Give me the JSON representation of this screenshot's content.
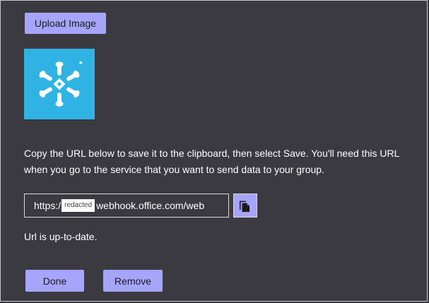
{
  "upload_button": {
    "label": "Upload Image"
  },
  "logo": {
    "icon": "snowflake-logo-icon",
    "background": "#2fb3e3"
  },
  "instructions": "Copy the URL below to save it to the clipboard, then select Save. You'll need this URL when you go to the service that you want to send data to your group.",
  "url_field": {
    "prefix": "https:/",
    "redacted_label": "redacted",
    "suffix": "webhook.office.com/web"
  },
  "copy_button": {
    "icon": "copy-icon"
  },
  "status_text": "Url is up-to-date.",
  "footer": {
    "done_label": "Done",
    "remove_label": "Remove"
  },
  "colors": {
    "background": "#3b3a40",
    "accent": "#a7a5fb",
    "logo_tile": "#2fb3e3"
  }
}
